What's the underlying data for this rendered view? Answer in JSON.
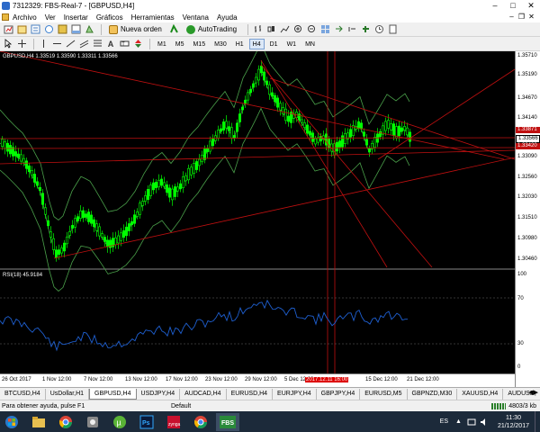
{
  "window": {
    "title": "7312329: FBS-Real-7 - [GBPUSD,H4]"
  },
  "menu": [
    "Archivo",
    "Ver",
    "Insertar",
    "Gráficos",
    "Herramientas",
    "Ventana",
    "Ayuda"
  ],
  "toolbar": {
    "new_order": "Nueva orden",
    "autotrading": "AutoTrading",
    "timeframes": [
      "M1",
      "M5",
      "M15",
      "M30",
      "H1",
      "H4",
      "D1",
      "W1",
      "MN"
    ],
    "active_timeframe": "H4"
  },
  "chart": {
    "info": "GBPUSD,H4  1.33519 1.33590 1.33311 1.33566",
    "rsi_info": "RSI(18) 45.9184",
    "price_ticks": [
      "1.35710",
      "1.35190",
      "1.34670",
      "1.34140",
      "1.33620",
      "1.33090",
      "1.32560",
      "1.32030",
      "1.31510",
      "1.30980",
      "1.30460"
    ],
    "price_tags": {
      "current": "1.33566",
      "red1": "1.33871",
      "red2": "1.33420"
    },
    "rsi_ticks": [
      "100",
      "70",
      "30",
      "0"
    ],
    "dates": [
      "26 Oct 2017",
      "1 Nov 12:00",
      "7 Nov 12:00",
      "13 Nov 12:00",
      "17 Nov 12:00",
      "23 Nov 12:00",
      "29 Nov 12:00",
      "5 Dec 12:00",
      "2017.12.11 16:00",
      "15 Dec 12:00",
      "21 Dec 12:00"
    ],
    "colors": {
      "bull": "#00ff00",
      "bear": "#00ff00",
      "rsi": "#1e5fd0",
      "trend": "#c01010",
      "bands": "#4aa04a"
    }
  },
  "tabs": [
    "BTCUSD,H4",
    "UsDollar,H1",
    "GBPUSD,H4",
    "USDJPY,H4",
    "AUDCAD,H4",
    "EURUSD,H4",
    "EURJPY,H4",
    "GBPJPY,H4",
    "EURUSD,M5",
    "GBPNZD,M30",
    "XAUUSD,H4",
    "AUDUSD,"
  ],
  "active_tab": "GBPUSD,H4",
  "status": {
    "help": "Para obtener ayuda, pulse F1",
    "profile": "Default",
    "traffic": "4803/3 kb"
  },
  "taskbar": {
    "lang": "ES",
    "time": "11:30",
    "date": "21/12/2017"
  }
}
